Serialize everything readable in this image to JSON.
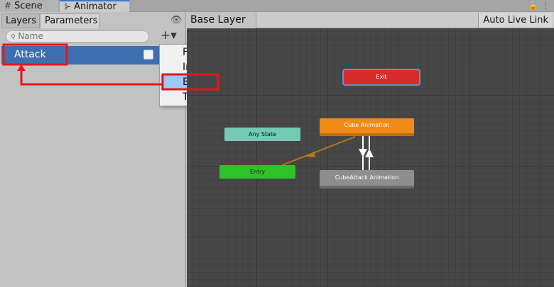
{
  "tabs": [
    {
      "icon": "#",
      "label": "Scene"
    },
    {
      "icon": "⊱",
      "label": "Animator"
    }
  ],
  "window_controls": "🔒 ⋮",
  "left": {
    "subtabs": [
      "Layers",
      "Parameters"
    ],
    "search": {
      "placeholder": "Name",
      "icon": "search-icon"
    },
    "add_button": "+▾",
    "parameters": [
      {
        "name": "Attack",
        "type": "Bool",
        "value": false
      }
    ]
  },
  "dropdown": {
    "items": [
      "Float",
      "Int",
      "Bool",
      "Trigger"
    ],
    "highlighted": "Bool"
  },
  "graph": {
    "breadcrumb": "Base Layer",
    "auto_live_link": "Auto Live Link",
    "states": {
      "exit": "Exit",
      "cube": "Cube Animation",
      "any": "Any State",
      "entry": "Entry",
      "cubeattack": "CubeAttack Animation"
    }
  },
  "colors": {
    "highlight_box": "#e8141c",
    "selection": "#3d6fb0",
    "exit_state": "#d92b2b",
    "default_state": "#f08b17",
    "any_state": "#72c9b5",
    "entry_state": "#2fc22a"
  }
}
